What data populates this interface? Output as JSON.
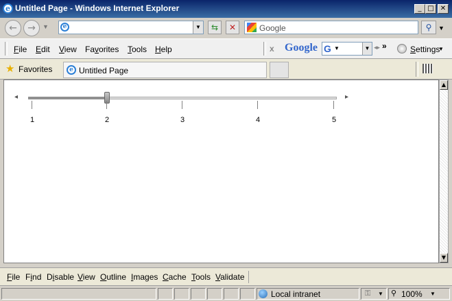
{
  "window": {
    "title": "Untitled Page - Windows Internet Explorer"
  },
  "address": {
    "url": "",
    "search_placeholder": "Google"
  },
  "menu": [
    "File",
    "Edit",
    "View",
    "Favorites",
    "Tools",
    "Help"
  ],
  "google_toolbar": {
    "logo": "Google",
    "settings_label": "Settings"
  },
  "favorites": {
    "label": "Favorites",
    "tab_title": "Untitled Page"
  },
  "slider": {
    "ticks": [
      "1",
      "2",
      "3",
      "4",
      "5"
    ],
    "value": 2
  },
  "dev_toolbar": [
    "File",
    "Find",
    "Disable",
    "View",
    "Outline",
    "Images",
    "Cache",
    "Tools",
    "Validate"
  ],
  "status": {
    "zone": "Local intranet",
    "zoom": "100%"
  }
}
